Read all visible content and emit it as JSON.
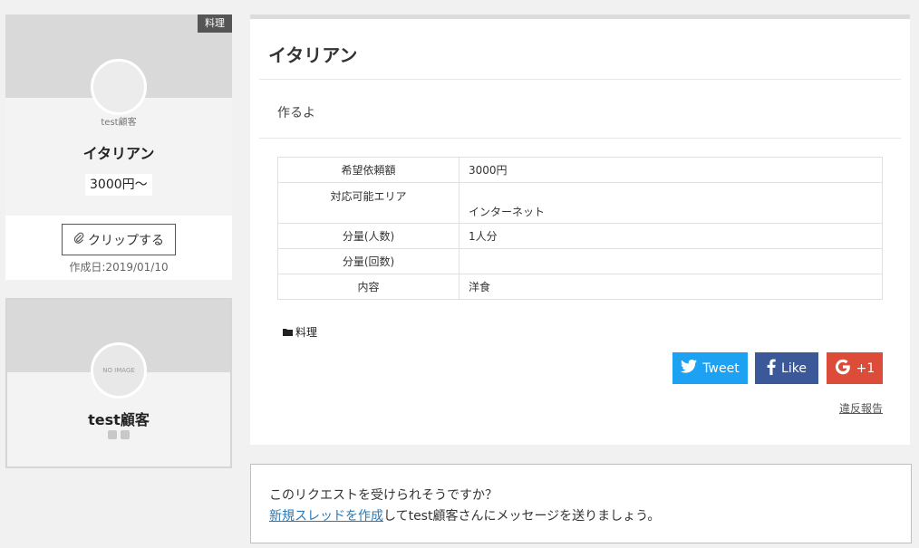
{
  "request_card": {
    "category_badge": "料理",
    "owner_name": "test顧客",
    "title": "イタリアン",
    "price": "3000円〜",
    "clip_button": "クリップする",
    "created": "作成日:2019/01/10"
  },
  "user_card": {
    "avatar_text": "NO IMAGE",
    "name": "test顧客"
  },
  "main": {
    "title": "イタリアン",
    "description": "作るよ",
    "details": [
      {
        "label": "希望依頼額",
        "value": "3000円"
      },
      {
        "label": "対応可能エリア",
        "value": "インターネット"
      },
      {
        "label": "分量(人数)",
        "value": "1人分"
      },
      {
        "label": "分量(回数)",
        "value": ""
      },
      {
        "label": "内容",
        "value": "洋食"
      }
    ],
    "tag": "料理",
    "share": {
      "tweet": "Tweet",
      "like": "Like",
      "plus": "+1"
    },
    "report": "違反報告"
  },
  "cta": {
    "question": "このリクエストを受けられそうですか？",
    "link_text": "新規スレッドを作成",
    "rest": "してtest顧客さんにメッセージを送りましょう。"
  },
  "colors": {
    "twitter": "#1da1f2",
    "facebook": "#3b5998",
    "google": "#dd4b39",
    "link": "#2a7ab7"
  }
}
